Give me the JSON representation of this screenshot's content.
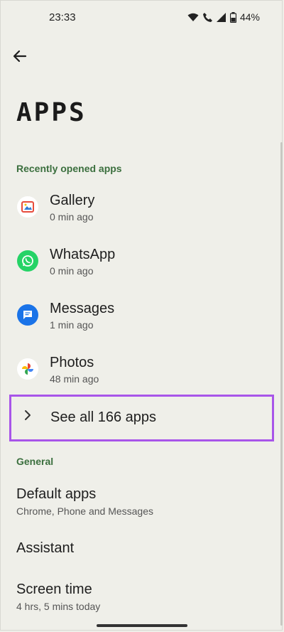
{
  "status": {
    "time": "23:33",
    "battery": "44%"
  },
  "title": "APPS",
  "recent": {
    "header": "Recently opened apps",
    "apps": [
      {
        "name": "Gallery",
        "time": "0 min ago",
        "icon": "gallery-icon"
      },
      {
        "name": "WhatsApp",
        "time": "0 min ago",
        "icon": "whatsapp-icon"
      },
      {
        "name": "Messages",
        "time": "1 min ago",
        "icon": "messages-icon"
      },
      {
        "name": "Photos",
        "time": "48 min ago",
        "icon": "photos-icon"
      }
    ]
  },
  "see_all": {
    "label": "See all 166 apps",
    "icon": "chevron-right-icon",
    "highlight_color": "#a855e9"
  },
  "general": {
    "header": "General",
    "items": [
      {
        "title": "Default apps",
        "subtitle": "Chrome, Phone and Messages"
      },
      {
        "title": "Assistant",
        "subtitle": ""
      },
      {
        "title": "Screen time",
        "subtitle": "4 hrs, 5 mins today"
      }
    ]
  },
  "colors": {
    "background": "#efefe9",
    "section_header": "#3b6f3e"
  }
}
